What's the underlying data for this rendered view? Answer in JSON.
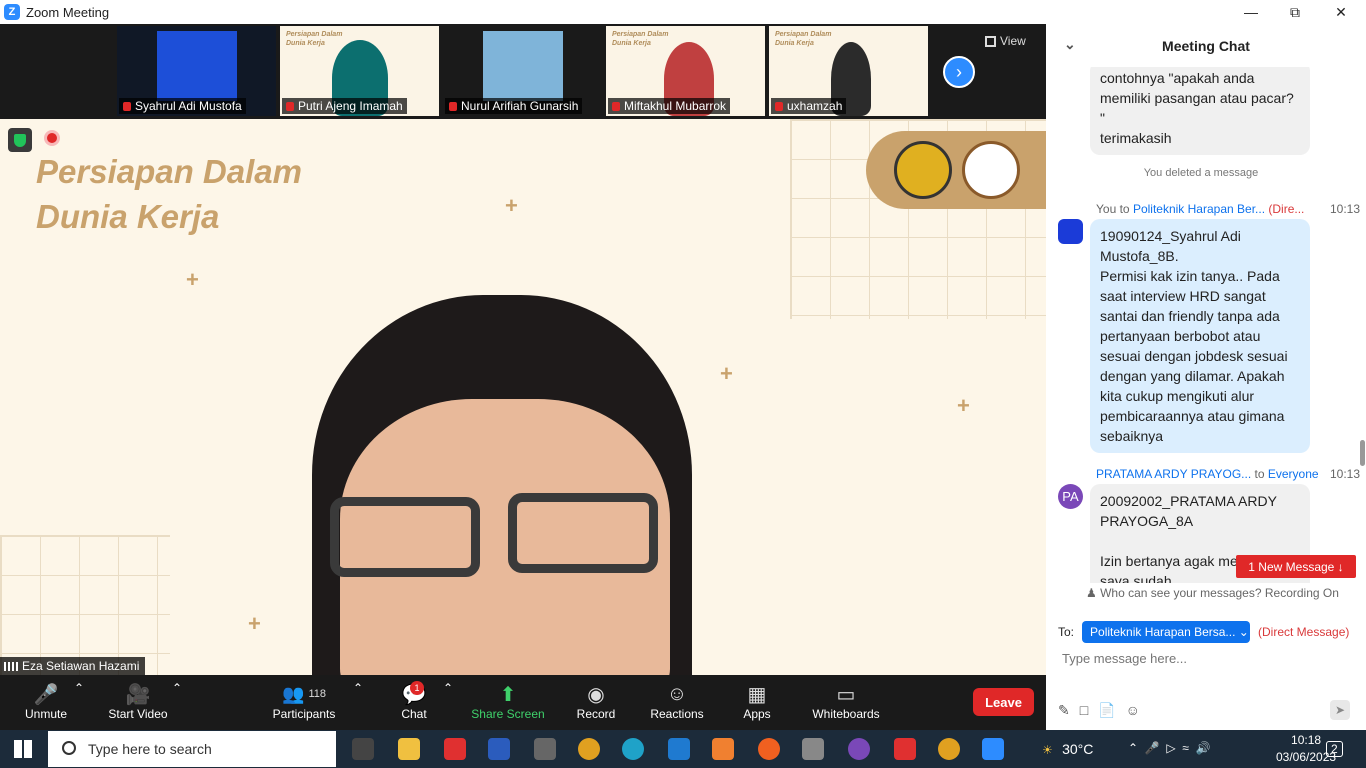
{
  "window": {
    "title": "Zoom Meeting",
    "app_icon": "Z"
  },
  "gallery": {
    "participants": [
      {
        "name": "Syahrul Adi Mustofa"
      },
      {
        "name": "Putri Ajeng Imamah"
      },
      {
        "name": "Nurul Arifiah Gunarsih"
      },
      {
        "name": "Miftakhul Mubarrok"
      },
      {
        "name": "uxhamzah"
      }
    ],
    "slide_thumb_title": "Persiapan Dalam\nDunia Kerja",
    "view_label": "View"
  },
  "stage": {
    "slide_title_line1": "Persiapan Dalam",
    "slide_title_line2": "Dunia Kerja",
    "speaker_name": "Eza Setiawan Hazami"
  },
  "toolbar": {
    "unmute": "Unmute",
    "start_video": "Start Video",
    "participants": "Participants",
    "participant_count": "118",
    "chat": "Chat",
    "chat_badge": "1",
    "share_screen": "Share Screen",
    "record": "Record",
    "reactions": "Reactions",
    "apps": "Apps",
    "whiteboards": "Whiteboards",
    "leave": "Leave"
  },
  "chat": {
    "header": "Meeting Chat",
    "messages": [
      {
        "text": "contohnya \"apakah anda memiliki pasangan atau pacar? \"\nterimakasih"
      },
      {
        "notice": "You deleted a message"
      },
      {
        "sender": "You",
        "to_word": "to",
        "recipient": "Politeknik Harapan Ber...",
        "tag": "(Dire...",
        "time": "10:13",
        "text": "19090124_Syahrul Adi Mustofa_8B.\nPermisi kak izin tanya.. Pada saat interview HRD sangat santai dan friendly tanpa ada pertanyaan berbobot atau sesuai dengan jobdesk sesuai dengan yang dilamar. Apakah kita cukup mengikuti alur pembicaraannya atau gimana sebaiknya"
      },
      {
        "sender": "PRATAMA ARDY PRAYOG...",
        "to_word": "to",
        "recipient": "Everyone",
        "time": "10:13",
        "avatar": "PA",
        "text": "20092002_PRATAMA ARDY PRAYOGA_8A\n\nIzin bertanya agak melenceng, saya sudah"
      }
    ],
    "new_message": "1 New Message",
    "visibility": "Who can see your messages? Recording On",
    "to_label": "To:",
    "to_value": "Politeknik Harapan Bersa...",
    "dm_label": "(Direct Message)",
    "input_placeholder": "Type message here..."
  },
  "taskbar": {
    "search_placeholder": "Type here to search",
    "weather": "30°C",
    "time": "10:18",
    "date": "03/06/2023",
    "notifications": "2"
  },
  "colors": {
    "zoom_blue": "#2d8cff",
    "accent_gold": "#c9a26c",
    "leave_red": "#e02828"
  }
}
